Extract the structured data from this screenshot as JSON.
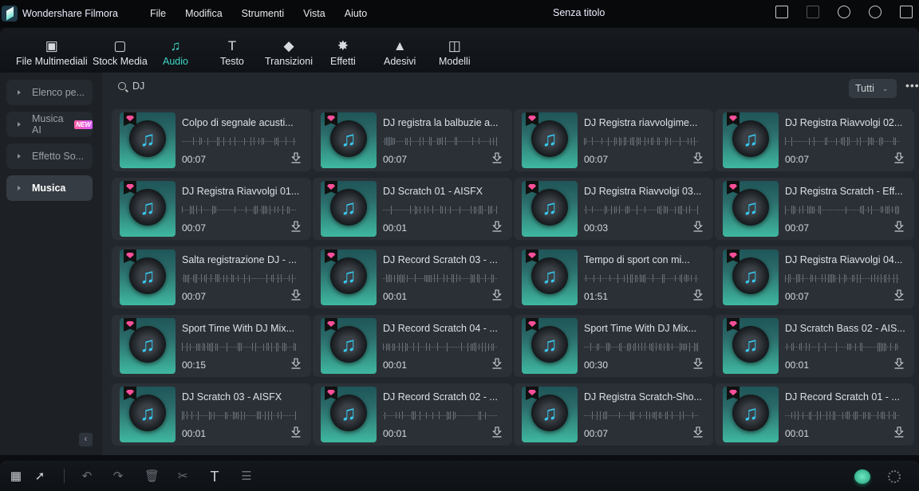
{
  "app": {
    "name": "Wondershare Filmora",
    "document_title": "Senza titolo"
  },
  "menu": [
    "File",
    "Modifica",
    "Strumenti",
    "Vista",
    "Aiuto"
  ],
  "window_icons": [
    "layout-icon",
    "save-icon",
    "cloud-sync-icon",
    "headset-icon",
    "apps-icon"
  ],
  "toolbar": [
    {
      "label": "File Multimediali",
      "icon": "media-icon",
      "glyph": "▣"
    },
    {
      "label": "Stock Media",
      "icon": "stock-folder-icon",
      "glyph": "▢"
    },
    {
      "label": "Audio",
      "icon": "music-note-icon",
      "glyph": "♫",
      "active": true
    },
    {
      "label": "Testo",
      "icon": "text-icon",
      "glyph": "T"
    },
    {
      "label": "Transizioni",
      "icon": "transition-icon",
      "glyph": "◆"
    },
    {
      "label": "Effetti",
      "icon": "effects-star-icon",
      "glyph": "✸"
    },
    {
      "label": "Adesivi",
      "icon": "sticker-icon",
      "glyph": "▲"
    },
    {
      "label": "Modelli",
      "icon": "template-icon",
      "glyph": "◫"
    }
  ],
  "accent": "#3fd6c6",
  "sidebar": {
    "items": [
      {
        "label": "Elenco pe..."
      },
      {
        "label": "Musica AI",
        "badge": "NEW"
      },
      {
        "label": "Effetto So..."
      },
      {
        "label": "Musica",
        "selected": true
      }
    ]
  },
  "search": {
    "value": "DJ"
  },
  "filter": {
    "selected": "Tutti"
  },
  "tracks": [
    {
      "title": "Colpo di segnale acusti...",
      "duration": "00:07"
    },
    {
      "title": "DJ registra la balbuzie a...",
      "duration": "00:07"
    },
    {
      "title": "DJ Registra riavvolgime...",
      "duration": "00:07"
    },
    {
      "title": "DJ Registra Riavvolgi 02...",
      "duration": "00:07"
    },
    {
      "title": "DJ Registra Riavvolgi 01...",
      "duration": "00:07"
    },
    {
      "title": "DJ Scratch 01 - AISFX",
      "duration": "00:01"
    },
    {
      "title": "DJ Registra Riavvolgi 03...",
      "duration": "00:03"
    },
    {
      "title": "DJ Registra Scratch - Eff...",
      "duration": "00:07"
    },
    {
      "title": "Salta registrazione DJ - ...",
      "duration": "00:07"
    },
    {
      "title": "DJ Record Scratch 03 - ...",
      "duration": "00:01"
    },
    {
      "title": "Tempo di sport con mi...",
      "duration": "01:51"
    },
    {
      "title": "DJ Registra Riavvolgi 04...",
      "duration": "00:07"
    },
    {
      "title": "Sport Time With DJ Mix...",
      "duration": "00:15"
    },
    {
      "title": "DJ Record Scratch 04 - ...",
      "duration": "00:01"
    },
    {
      "title": "Sport Time With DJ Mix...",
      "duration": "00:30"
    },
    {
      "title": "DJ Scratch Bass 02 - AIS...",
      "duration": "00:01"
    },
    {
      "title": "DJ Scratch 03 - AISFX",
      "duration": "00:01"
    },
    {
      "title": "DJ Record Scratch 02 - ...",
      "duration": "00:01"
    },
    {
      "title": "DJ Registra Scratch-Sho...",
      "duration": "00:07"
    },
    {
      "title": "DJ Record Scratch 01 - ...",
      "duration": "00:01"
    }
  ],
  "bottom_tools": [
    "grid-icon",
    "select-arrow-icon",
    "undo-icon",
    "redo-icon",
    "delete-icon",
    "scissors-icon",
    "text-tool-icon",
    "adjust-icon"
  ]
}
